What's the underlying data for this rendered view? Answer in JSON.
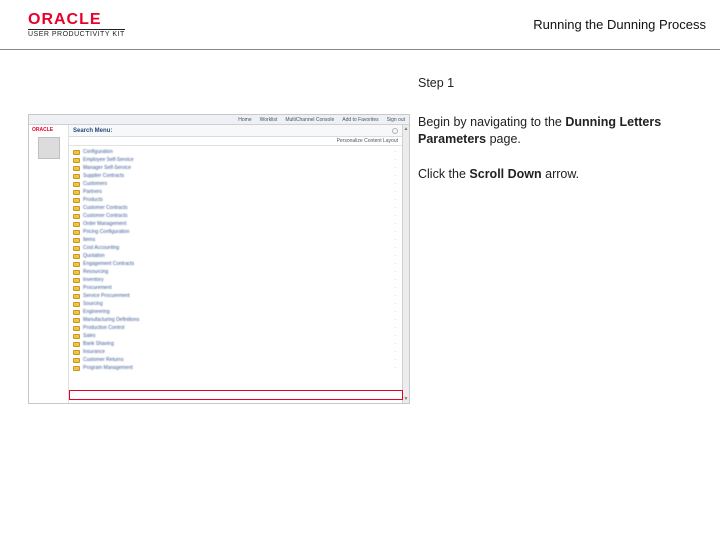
{
  "header": {
    "brand_word": "ORACLE",
    "brand_sub": "USER PRODUCTIVITY KIT",
    "page_title": "Running the Dunning Process"
  },
  "instructions": {
    "step_label": "Step 1",
    "line1_pre": "Begin by navigating to the ",
    "line1_bold": "Dunning Letters Parameters",
    "line1_post": " page.",
    "line2_pre": "Click the ",
    "line2_bold": "Scroll Down",
    "line2_post": " arrow."
  },
  "screenshot": {
    "mini_brand": "ORACLE",
    "top_links": [
      "Home",
      "Worklist",
      "MultiChannel Console",
      "Add to Favorites",
      "Sign out"
    ],
    "menu_title": "Search Menu:",
    "subbar_text": "Personalize Content   Layout",
    "scroll_up": "▲",
    "scroll_down": "▼",
    "menu_items": [
      "Configuration",
      "Employee Self-Service",
      "Manager Self-Service",
      "Supplier Contracts",
      "Customers",
      "Partners",
      "Products",
      "Customer Contracts",
      "Customer Contracts",
      "Order Management",
      "Pricing Configuration",
      "Items",
      "Cost Accounting",
      "Quotation",
      "Engagement Contracts",
      "Resourcing",
      "Inventory",
      "Procurement",
      "Service Procurement",
      "Sourcing",
      "Engineering",
      "Manufacturing Definitions",
      "Production Control",
      "Sales",
      "Bank Shaving",
      "Insurance",
      "Customer Returns",
      "Program Management"
    ]
  }
}
